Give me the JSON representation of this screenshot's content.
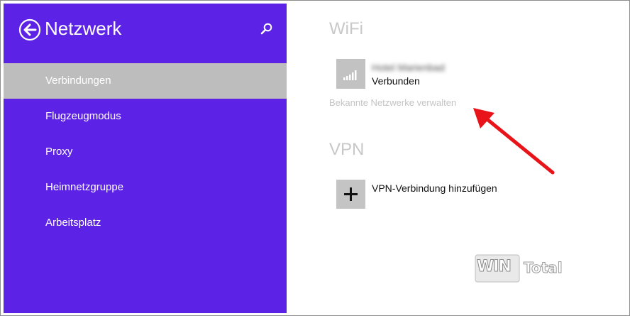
{
  "sidebar": {
    "title": "Netzwerk",
    "back_icon": "back-arrow-circle-icon",
    "search_icon": "search-icon",
    "items": [
      {
        "label": "Verbindungen",
        "selected": true
      },
      {
        "label": "Flugzeugmodus",
        "selected": false
      },
      {
        "label": "Proxy",
        "selected": false
      },
      {
        "label": "Heimnetzgruppe",
        "selected": false
      },
      {
        "label": "Arbeitsplatz",
        "selected": false
      }
    ]
  },
  "main": {
    "wifi": {
      "title": "WiFi",
      "network_name": "Hotel Marienbad",
      "network_status": "Verbunden",
      "signal_icon": "wifi-signal-bars-icon",
      "manage_link": "Bekannte Netzwerke verwalten"
    },
    "vpn": {
      "title": "VPN",
      "add_label": "VPN-Verbindung hinzufügen",
      "add_icon": "plus-icon"
    }
  },
  "watermark": {
    "win": "WIN",
    "total": "Total"
  },
  "colors": {
    "sidebar_bg": "#5c22e6",
    "selected_bg": "#bdbdbd",
    "annotation_arrow": "#e8141a"
  }
}
